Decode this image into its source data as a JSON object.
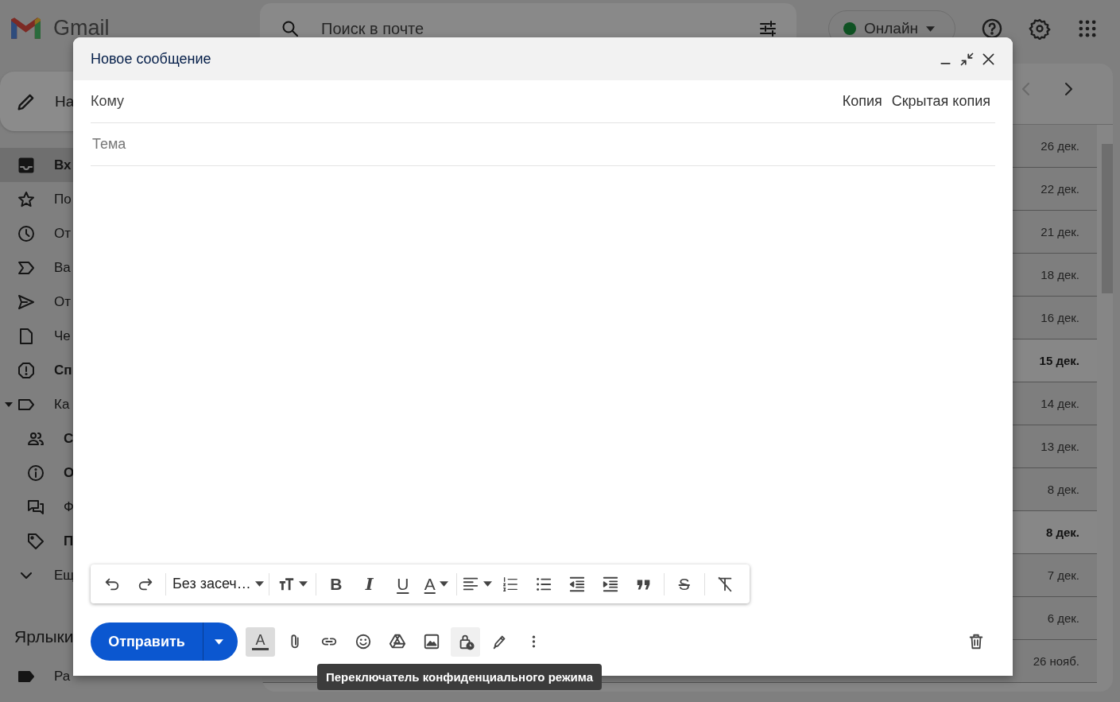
{
  "app": {
    "name": "Gmail"
  },
  "search": {
    "placeholder": "Поиск в почте"
  },
  "status": {
    "label": "Онлайн",
    "online": true
  },
  "sidebar": {
    "compose": "На",
    "items": [
      {
        "kind": "inbox",
        "label": "Вх",
        "bold": true,
        "selected": true
      },
      {
        "kind": "star",
        "label": "По",
        "bold": false,
        "selected": false
      },
      {
        "kind": "clock",
        "label": "От",
        "bold": false,
        "selected": false
      },
      {
        "kind": "important",
        "label": "Ва",
        "bold": false,
        "selected": false
      },
      {
        "kind": "send",
        "label": "От",
        "bold": false,
        "selected": false
      },
      {
        "kind": "draft",
        "label": "Че",
        "bold": false,
        "selected": false
      },
      {
        "kind": "spam",
        "label": "Сп",
        "bold": true,
        "selected": false
      },
      {
        "kind": "category",
        "label": "Ка",
        "bold": false,
        "selected": false,
        "expanded": true,
        "children": [
          {
            "kind": "people",
            "label": "С",
            "bold": true,
            "selected": false
          },
          {
            "kind": "info",
            "label": "О",
            "bold": true,
            "selected": false
          },
          {
            "kind": "forum",
            "label": "Ф",
            "bold": false,
            "selected": false
          },
          {
            "kind": "tag",
            "label": "П",
            "bold": true,
            "selected": false
          }
        ]
      },
      {
        "kind": "more",
        "label": "Ещ",
        "bold": false,
        "selected": false
      }
    ],
    "labels_heading": "Ярлыки",
    "labels": [
      {
        "label": "Ра"
      }
    ]
  },
  "mail_list": {
    "rows": [
      {
        "date": "26 дек.",
        "unread": false
      },
      {
        "date": "22 дек.",
        "unread": false
      },
      {
        "date": "21 дек.",
        "unread": false
      },
      {
        "date": "18 дек.",
        "unread": false
      },
      {
        "date": "16 дек.",
        "unread": false
      },
      {
        "date": "15 дек.",
        "unread": true
      },
      {
        "date": "14 дек.",
        "unread": false
      },
      {
        "date": "13 дек.",
        "unread": false
      },
      {
        "date": "8 дек.",
        "unread": false
      },
      {
        "date": "8 дек.",
        "unread": true
      },
      {
        "date": "7 дек.",
        "unread": false
      },
      {
        "date": "6 дек.",
        "unread": false
      },
      {
        "date": "26 нояб.",
        "unread": false
      }
    ]
  },
  "compose": {
    "title": "Новое сообщение",
    "to_label": "Кому",
    "cc": "Копия",
    "bcc": "Скрытая копия",
    "subject_placeholder": "Тема",
    "format_toolbar": {
      "groups": [
        [
          {
            "kind": "undo"
          },
          {
            "kind": "redo"
          }
        ],
        [
          {
            "kind": "font",
            "label": "Без засеч…",
            "dropdown": true
          }
        ],
        [
          {
            "kind": "size",
            "dropdown": true
          }
        ],
        [
          {
            "kind": "bold",
            "glyph": "B"
          },
          {
            "kind": "italic",
            "glyph": "I"
          },
          {
            "kind": "underline",
            "glyph": "U"
          },
          {
            "kind": "color",
            "glyph": "A",
            "dropdown": true
          }
        ],
        [
          {
            "kind": "align",
            "dropdown": true
          },
          {
            "kind": "numbered"
          },
          {
            "kind": "bulleted"
          },
          {
            "kind": "indent-less"
          },
          {
            "kind": "indent-more"
          },
          {
            "kind": "quote"
          }
        ],
        [
          {
            "kind": "strike",
            "glyph": "S"
          }
        ],
        [
          {
            "kind": "clear"
          }
        ]
      ]
    },
    "send": "Отправить",
    "tools": [
      {
        "kind": "formatting",
        "glyph": "A",
        "selected": true,
        "hovered": false
      },
      {
        "kind": "attach",
        "selected": false,
        "hovered": false
      },
      {
        "kind": "link",
        "selected": false,
        "hovered": false
      },
      {
        "kind": "emoji",
        "selected": false,
        "hovered": false
      },
      {
        "kind": "drive",
        "selected": false,
        "hovered": false
      },
      {
        "kind": "photo",
        "selected": false,
        "hovered": false
      },
      {
        "kind": "confidential",
        "selected": false,
        "hovered": true
      },
      {
        "kind": "signature",
        "selected": false,
        "hovered": false
      },
      {
        "kind": "more",
        "selected": false,
        "hovered": false
      }
    ]
  },
  "tooltip": "Переключатель конфиденциального режима"
}
